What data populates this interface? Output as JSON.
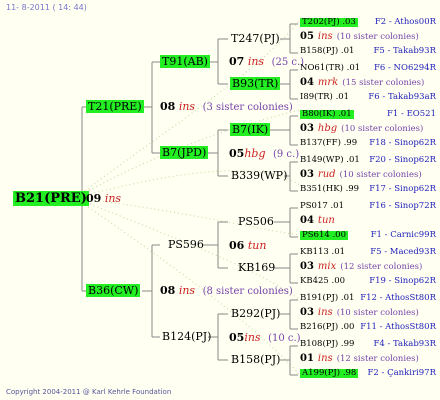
{
  "header": "11- 8-2011 ( 14: 44)",
  "footer": "Copyright 2004-2011 @ Karl Kehrle Foundation",
  "colors": {
    "green_box": "#22ee22",
    "line": "#888888",
    "dots": "#c8e0a8",
    "blue": "#2222bb",
    "red": "#cc2222",
    "purple": "#7744aa"
  },
  "root": {
    "name": "B21(PRE)",
    "year": "09",
    "race": "ins"
  },
  "gen1": [
    {
      "name": "T21(PRE)",
      "year": "08",
      "race": "ins",
      "note": "(3 sister colonies)"
    },
    {
      "name": "B36(CW)",
      "year": "08",
      "race": "ins",
      "note": "(8 sister colonies)"
    }
  ],
  "gen2": [
    {
      "name": "T91(AB)",
      "year": "07",
      "race": "ins",
      "note": "(25 c.)"
    },
    {
      "name": "B7(JPD)",
      "year": "05",
      "race": "hbg",
      "note": "(9 c.)"
    },
    {
      "name": "PS596",
      "year": "06",
      "race": "tun",
      "note": ""
    },
    {
      "name": "B124(PJ)",
      "year": "05",
      "race": "ins",
      "note": "(10 c.)"
    }
  ],
  "gen3": [
    {
      "name": "T247(PJ)"
    },
    {
      "name": "B93(TR)"
    },
    {
      "name": "B7(IK)"
    },
    {
      "name": "B339(WP)"
    },
    {
      "name": "PS506"
    },
    {
      "name": "KB169"
    },
    {
      "name": "B292(PJ)"
    },
    {
      "name": "B158(PJ)"
    }
  ],
  "gen4": [
    {
      "queen": "T202(PJ) .03",
      "breeder": "F2 - Athos00R"
    },
    {
      "year": "05",
      "race": "ins",
      "note": "(10 sister colonies)"
    },
    {
      "queen": "B158(PJ) .01",
      "breeder": "F5 - Takab93R"
    },
    {
      "queen": "NO61(TR) .01",
      "breeder": "F6 - NO6294R"
    },
    {
      "year": "04",
      "race": "mrk",
      "note": "(15 sister colonies)"
    },
    {
      "queen": "I89(TR) .01",
      "breeder": "F6 - Takab93aR"
    },
    {
      "queen": "B80(IK) .01",
      "breeder": "F1 - EO521"
    },
    {
      "year": "03",
      "race": "hbg",
      "note": "(10 sister colonies)"
    },
    {
      "queen": "B137(FF) .99",
      "breeder": "F18 - Sinop62R"
    },
    {
      "queen": "B149(WP) .01",
      "breeder": "F20 - Sinop62R"
    },
    {
      "year": "03",
      "race": "rud",
      "note": "(10 sister colonies)"
    },
    {
      "queen": "B351(HK) .99",
      "breeder": "F17 - Sinop62R"
    },
    {
      "queen": "PS017 .01",
      "breeder": "F16 - Sinop72R"
    },
    {
      "year": "04",
      "race": "tun",
      "note": ""
    },
    {
      "queen": "PS614 .00",
      "breeder": "F1 - Carnic99R"
    },
    {
      "queen": "KB113 .01",
      "breeder": "F5 - Maced93R"
    },
    {
      "year": "03",
      "race": "mix",
      "note": "(12 sister colonies)"
    },
    {
      "queen": "KB425 .00",
      "breeder": "F19 - Sinop62R"
    },
    {
      "queen": "B191(PJ) .01",
      "breeder": "F12 - AthosSt80R"
    },
    {
      "year": "03",
      "race": "ins",
      "note": "(10 sister colonies)"
    },
    {
      "queen": "B216(PJ) .00",
      "breeder": "F11 - AthosSt80R"
    },
    {
      "queen": "B108(PJ) .99",
      "breeder": "F4 - Takab93R"
    },
    {
      "year": "01",
      "race": "ins",
      "note": "(12 sister colonies)"
    },
    {
      "queen": "A199(PJ) .98",
      "breeder": "F2 - Çankiri97R"
    }
  ]
}
